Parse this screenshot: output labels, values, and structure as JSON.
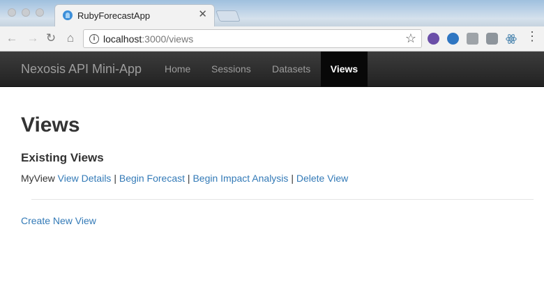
{
  "browser": {
    "tab_title": "RubyForecastApp",
    "url_host": "localhost",
    "url_path": ":3000/views"
  },
  "icons": {
    "back": "arrow-left-icon",
    "forward": "arrow-right-icon",
    "reload": "reload-icon",
    "home": "home-icon",
    "info": "info-icon",
    "star": "star-icon",
    "menu": "kebab-menu-icon"
  },
  "navbar": {
    "brand": "Nexosis API Mini-App",
    "links": [
      "Home",
      "Sessions",
      "Datasets",
      "Views"
    ],
    "active": "Views"
  },
  "page": {
    "title": "Views",
    "section_title": "Existing Views",
    "views": [
      {
        "name": "MyView",
        "actions": [
          "View Details",
          "Begin Forecast",
          "Begin Impact Analysis",
          "Delete View"
        ]
      }
    ],
    "create_link": "Create New View"
  },
  "colors": {
    "link": "#337ab7",
    "navbar_bg": "#222222",
    "navbar_active_bg": "#080808",
    "navbar_text": "#9d9d9d"
  }
}
